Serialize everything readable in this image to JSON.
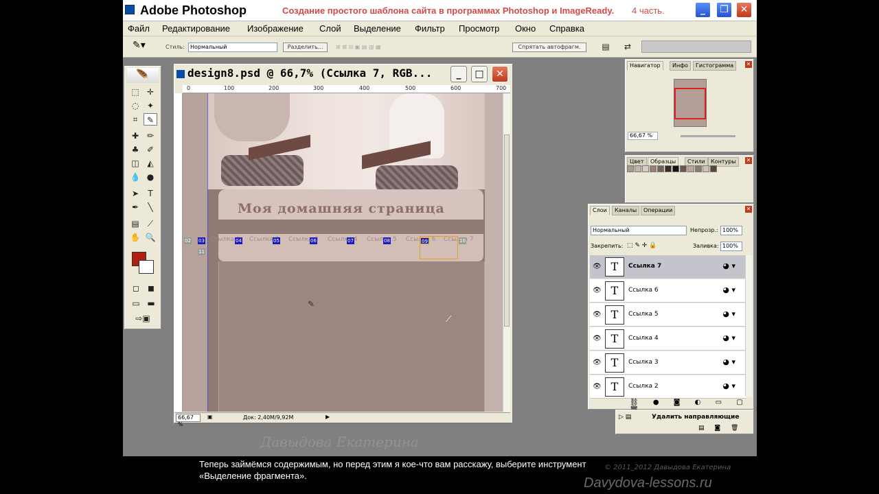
{
  "window": {
    "app_title": "Adobe Photoshop",
    "video_title": "Создание простого шаблона сайта в программах Photoshop и ImageReady.",
    "part": "4 часть."
  },
  "menu": [
    "Файл",
    "Редактирование",
    "Изображение",
    "Слой",
    "Выделение",
    "Фильтр",
    "Просмотр",
    "Окно",
    "Справка"
  ],
  "options": {
    "style_label": "Стиль:",
    "style_value": "Нормальный",
    "dim_text": "Разделить...",
    "hide_autoslices": "Спрятать автофрагм."
  },
  "document": {
    "title": "design8.psd @ 66,7% (Ссылка 7, RGB...",
    "ruler_marks": [
      "0",
      "100",
      "200",
      "300",
      "400",
      "500",
      "600",
      "700"
    ],
    "zoom": "66,67 %",
    "doc_info": "Док: 2,40M/9,92M",
    "site_title": "Моя домашняя страница",
    "slices": [
      "02",
      "03",
      "04",
      "05",
      "06",
      "07",
      "08",
      "09",
      "10",
      "11"
    ],
    "nav_links": [
      "Ссылка 1",
      "Ссылка 2",
      "Ссылка 3",
      "Ссылка 4",
      "Ссылка 5",
      "Ссылка 6",
      "Ссылка 7"
    ]
  },
  "navigator": {
    "tabs": [
      "Навигатор",
      "Инфо",
      "Гистограмма"
    ],
    "zoom": "66,67 %"
  },
  "swatches": {
    "tabs": [
      "Цвет",
      "Образцы",
      "Стили",
      "Контуры"
    ],
    "colors": [
      "#a89a92",
      "#c4b5ae",
      "#d8ccc6",
      "#9a7f78",
      "#7a625c",
      "#3a2a28",
      "#1a1010",
      "#6c5650",
      "#b9a49e",
      "#8e7872",
      "#d0c0ba",
      "#5a4440"
    ]
  },
  "layers": {
    "tabs": [
      "Слои",
      "Каналы",
      "Операции"
    ],
    "blend_mode": "Нормальный",
    "opacity_label": "Непрозр.:",
    "opacity": "100%",
    "lock_label": "Закрепить:",
    "fill_label": "Заливка:",
    "fill": "100%",
    "items": [
      {
        "name": "Ссылка 7",
        "selected": true
      },
      {
        "name": "Ссылка 6",
        "selected": false
      },
      {
        "name": "Ссылка 5",
        "selected": false
      },
      {
        "name": "Ссылка 4",
        "selected": false
      },
      {
        "name": "Ссылка 3",
        "selected": false
      },
      {
        "name": "Ссылка 2",
        "selected": false
      }
    ]
  },
  "actions": {
    "item": "Удалить направляющие"
  },
  "caption": {
    "line1": "Теперь займёмся содержимым, но перед этим я кое-что вам расскажу, выберите инструмент",
    "line2": "«Выделение фрагмента»."
  },
  "watermarks": {
    "author": "Давыдова Екатерина",
    "site": "Davydova-lessons.ru",
    "copyright": "© 2011_2012 Давыдова Екатерина"
  }
}
